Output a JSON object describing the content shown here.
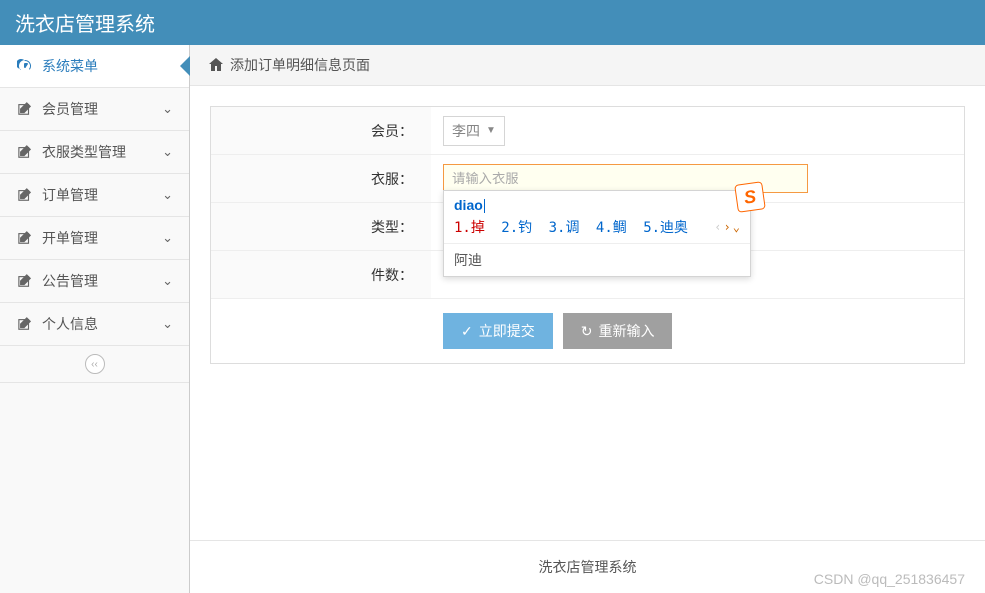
{
  "header": {
    "title": "洗衣店管理系统"
  },
  "sidebar": {
    "items": [
      {
        "label": "系统菜单",
        "icon": "dashboard"
      },
      {
        "label": "会员管理",
        "icon": "edit"
      },
      {
        "label": "衣服类型管理",
        "icon": "edit"
      },
      {
        "label": "订单管理",
        "icon": "edit"
      },
      {
        "label": "开单管理",
        "icon": "edit"
      },
      {
        "label": "公告管理",
        "icon": "edit"
      },
      {
        "label": "个人信息",
        "icon": "edit"
      }
    ]
  },
  "breadcrumb": {
    "text": "添加订单明细信息页面"
  },
  "form": {
    "member_label": "会员：",
    "member_value": "李四",
    "clothes_label": "衣服：",
    "clothes_placeholder": "请输入衣服",
    "clothes_value": "",
    "type_label": "类型：",
    "count_label": "件数：",
    "submit_label": "立即提交",
    "reset_label": "重新输入"
  },
  "ime": {
    "input": "diao",
    "candidates": [
      {
        "num": "1.",
        "text": "掉"
      },
      {
        "num": "2.",
        "text": "钓"
      },
      {
        "num": "3.",
        "text": "调"
      },
      {
        "num": "4.",
        "text": "鲷"
      },
      {
        "num": "5.",
        "text": "迪奥"
      }
    ],
    "suggestion": "阿迪",
    "logo": "S"
  },
  "footer": {
    "text": "洗衣店管理系统"
  },
  "watermark": "CSDN @qq_251836457"
}
